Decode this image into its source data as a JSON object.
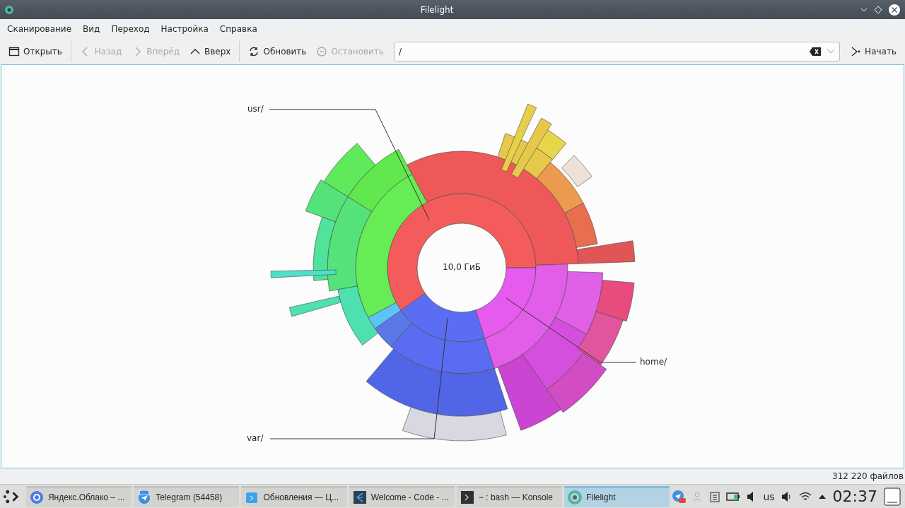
{
  "window": {
    "title": "Filelight"
  },
  "menu": [
    "Сканирование",
    "Вид",
    "Переход",
    "Настройка",
    "Справка"
  ],
  "toolbar": [
    {
      "kind": "open",
      "label": "Открыть",
      "disabled": false
    },
    {
      "kind": "back",
      "label": "Назад",
      "disabled": true
    },
    {
      "kind": "forward",
      "label": "Вперёд",
      "disabled": true
    },
    {
      "kind": "up",
      "label": "Вверх",
      "disabled": false
    },
    {
      "kind": "refresh",
      "label": "Обновить",
      "disabled": false
    },
    {
      "kind": "stop",
      "label": "Остановить",
      "disabled": true
    }
  ],
  "location": {
    "value": "/"
  },
  "start_button": {
    "label": "Начать"
  },
  "map": {
    "center_label": "10,0 ГиБ",
    "labels": [
      {
        "kind": "usr",
        "text": "usr/"
      },
      {
        "kind": "home",
        "text": "home/"
      },
      {
        "kind": "var",
        "text": "var/"
      }
    ]
  },
  "status_bar": {
    "files": "312 220 файлов"
  },
  "taskbar": {
    "tasks": [
      {
        "kind": "browser",
        "label": "Яндекс.Облако – ...",
        "selected": false
      },
      {
        "kind": "telegram",
        "label": "Telegram (54458)",
        "selected": false
      },
      {
        "kind": "updates",
        "label": "Обновления — Ц...",
        "selected": false
      },
      {
        "kind": "code",
        "label": "Welcome - Code - ...",
        "selected": false
      },
      {
        "kind": "terminal",
        "label": "~ : bash — Konsole",
        "selected": false
      },
      {
        "kind": "filelight",
        "label": "Filelight",
        "selected": true
      }
    ],
    "layout": "us",
    "clock": "02:37"
  }
}
